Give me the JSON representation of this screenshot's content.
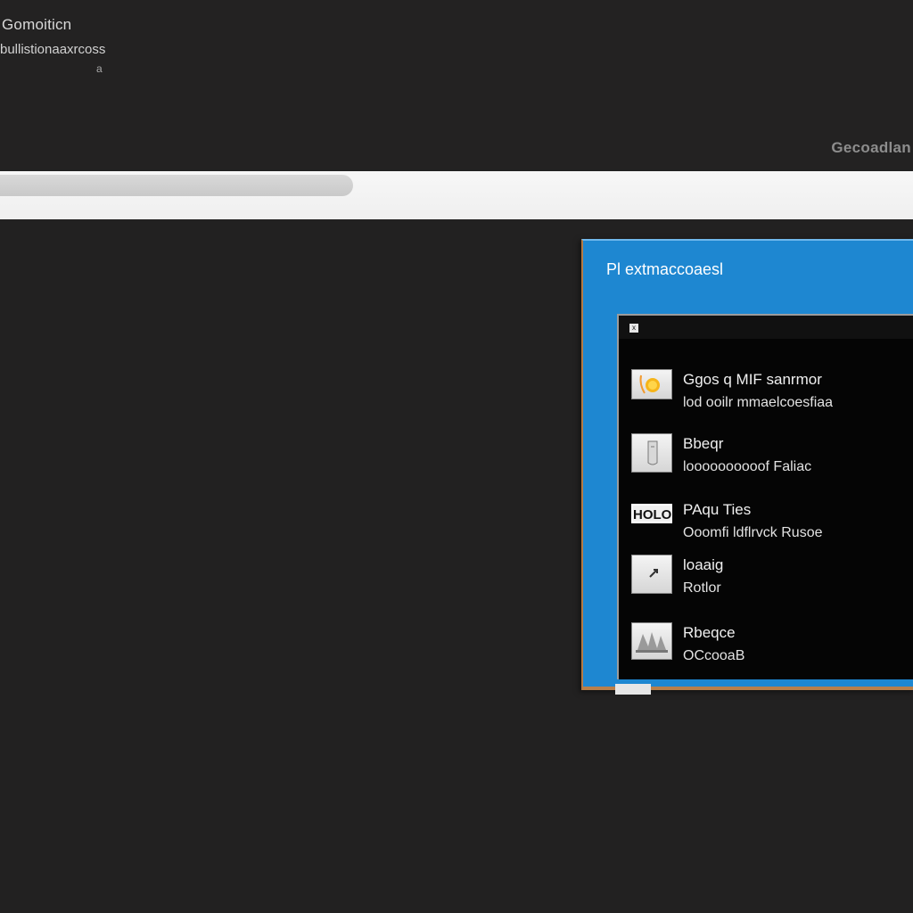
{
  "app": {
    "title": "Gomoiticn",
    "subtitle": "bullistionaaxrcoss",
    "meta": "a"
  },
  "header": {
    "right_label": "Gecoadlan"
  },
  "address_bar": {
    "value": ""
  },
  "dialog": {
    "title": "Pl extmaccoaesl",
    "inner_close_symbol": "x",
    "items": [
      {
        "title": "Ggos q MIF sanrmor",
        "description": "lod ooilr mmaelcoesfiaa",
        "icon": "sun-icon"
      },
      {
        "title": "Bbeqr",
        "description": "loooooooooof Faliac",
        "icon": "document-icon"
      },
      {
        "title": "PAqu Ties",
        "description": "Ooomfi ldflrvck Rusoe",
        "icon": "label-icon",
        "icon_label": "HOLO"
      },
      {
        "title": "loaaig",
        "description": "Rotlor",
        "icon": "arrow-icon"
      },
      {
        "title": "Rbeqce",
        "description": "OCcooaB",
        "icon": "image-icon"
      }
    ]
  },
  "colors": {
    "background": "#222121",
    "dialog_blue": "#1e87d1",
    "dialog_border": "#b97f4a",
    "inner_panel": "#050505"
  }
}
